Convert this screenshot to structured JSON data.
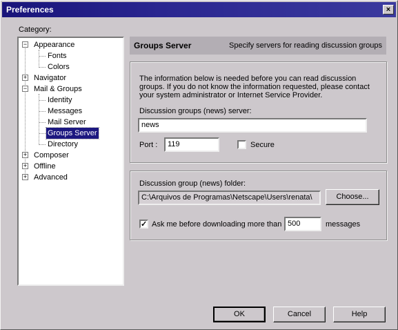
{
  "window": {
    "title": "Preferences",
    "close_label": "×"
  },
  "category_label": "Category:",
  "tree": [
    {
      "label": "Appearance",
      "level": 0,
      "expander": "−"
    },
    {
      "label": "Fonts",
      "level": 1
    },
    {
      "label": "Colors",
      "level": 1
    },
    {
      "label": "Navigator",
      "level": 0,
      "expander": "+"
    },
    {
      "label": "Mail & Groups",
      "level": 0,
      "expander": "−"
    },
    {
      "label": "Identity",
      "level": 1
    },
    {
      "label": "Messages",
      "level": 1
    },
    {
      "label": "Mail Server",
      "level": 1
    },
    {
      "label": "Groups Server",
      "level": 1,
      "selected": true
    },
    {
      "label": "Directory",
      "level": 1
    },
    {
      "label": "Composer",
      "level": 0,
      "expander": "+"
    },
    {
      "label": "Offline",
      "level": 0,
      "expander": "+"
    },
    {
      "label": "Advanced",
      "level": 0,
      "expander": "+"
    }
  ],
  "header": {
    "title": "Groups Server",
    "description": "Specify servers for reading discussion groups"
  },
  "info_text": "The information below is needed before you can read discussion groups.  If you do not know the information requested, please contact your system administrator or Internet Service Provider.",
  "server": {
    "label": "Discussion groups (news) server:",
    "value": "news"
  },
  "port": {
    "label": "Port :",
    "value": "119"
  },
  "secure": {
    "label": "Secure",
    "checked": false
  },
  "folder": {
    "label": "Discussion group (news) folder:",
    "value": "C:\\Arquivos de Programas\\Netscape\\Users\\renata\\",
    "choose_label": "Choose..."
  },
  "download": {
    "checked": true,
    "prefix": "Ask me before downloading more than",
    "value": "500",
    "suffix": "messages"
  },
  "buttons": {
    "ok": "OK",
    "cancel": "Cancel",
    "help": "Help"
  }
}
